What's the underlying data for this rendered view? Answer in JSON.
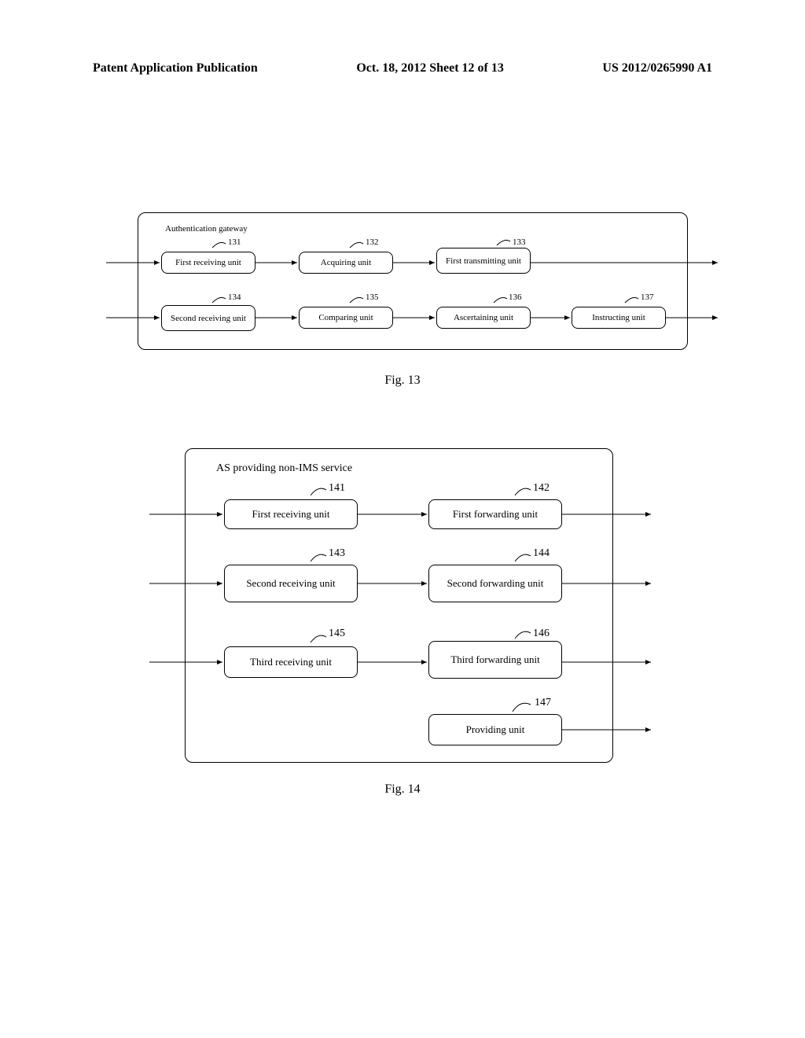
{
  "header": {
    "left": "Patent Application Publication",
    "center": "Oct. 18, 2012  Sheet 12 of 13",
    "right": "US 2012/0265990 A1"
  },
  "fig13": {
    "title": "Authentication gateway",
    "caption": "Fig. 13",
    "boxes": {
      "b131": {
        "label": "First receiving unit",
        "ref": "131"
      },
      "b132": {
        "label": "Acquiring unit",
        "ref": "132"
      },
      "b133": {
        "label": "First transmitting unit",
        "ref": "133"
      },
      "b134": {
        "label": "Second receiving unit",
        "ref": "134"
      },
      "b135": {
        "label": "Comparing unit",
        "ref": "135"
      },
      "b136": {
        "label": "Ascertaining unit",
        "ref": "136"
      },
      "b137": {
        "label": "Instructing unit",
        "ref": "137"
      }
    }
  },
  "fig14": {
    "title": "AS providing non-IMS service",
    "caption": "Fig. 14",
    "boxes": {
      "b141": {
        "label": "First receiving unit",
        "ref": "141"
      },
      "b142": {
        "label": "First forwarding unit",
        "ref": "142"
      },
      "b143": {
        "label": "Second receiving unit",
        "ref": "143"
      },
      "b144": {
        "label": "Second forwarding unit",
        "ref": "144"
      },
      "b145": {
        "label": "Third receiving unit",
        "ref": "145"
      },
      "b146": {
        "label": "Third forwarding unit",
        "ref": "146"
      },
      "b147": {
        "label": "Providing unit",
        "ref": "147"
      }
    }
  }
}
